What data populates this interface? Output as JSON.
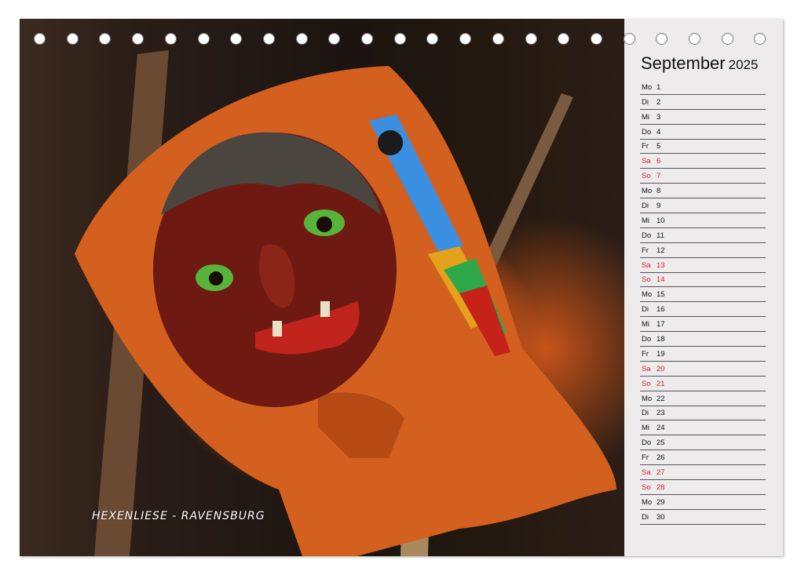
{
  "photo": {
    "caption": "HEXENLIESE - RAVENSBURG"
  },
  "calendar": {
    "month": "September",
    "year": "2025",
    "accent_weekend_color": "#d0202a",
    "days": [
      {
        "wd": "Mo",
        "d": "1",
        "weekend": false
      },
      {
        "wd": "Di",
        "d": "2",
        "weekend": false
      },
      {
        "wd": "Mi",
        "d": "3",
        "weekend": false
      },
      {
        "wd": "Do",
        "d": "4",
        "weekend": false
      },
      {
        "wd": "Fr",
        "d": "5",
        "weekend": false
      },
      {
        "wd": "Sa",
        "d": "6",
        "weekend": true
      },
      {
        "wd": "So",
        "d": "7",
        "weekend": true
      },
      {
        "wd": "Mo",
        "d": "8",
        "weekend": false
      },
      {
        "wd": "Di",
        "d": "9",
        "weekend": false
      },
      {
        "wd": "Mi",
        "d": "10",
        "weekend": false
      },
      {
        "wd": "Do",
        "d": "11",
        "weekend": false
      },
      {
        "wd": "Fr",
        "d": "12",
        "weekend": false
      },
      {
        "wd": "Sa",
        "d": "13",
        "weekend": true
      },
      {
        "wd": "So",
        "d": "14",
        "weekend": true
      },
      {
        "wd": "Mo",
        "d": "15",
        "weekend": false
      },
      {
        "wd": "Di",
        "d": "16",
        "weekend": false
      },
      {
        "wd": "Mi",
        "d": "17",
        "weekend": false
      },
      {
        "wd": "Do",
        "d": "18",
        "weekend": false
      },
      {
        "wd": "Fr",
        "d": "19",
        "weekend": false
      },
      {
        "wd": "Sa",
        "d": "20",
        "weekend": true
      },
      {
        "wd": "So",
        "d": "21",
        "weekend": true
      },
      {
        "wd": "Mo",
        "d": "22",
        "weekend": false
      },
      {
        "wd": "Di",
        "d": "23",
        "weekend": false
      },
      {
        "wd": "Mi",
        "d": "24",
        "weekend": false
      },
      {
        "wd": "Do",
        "d": "25",
        "weekend": false
      },
      {
        "wd": "Fr",
        "d": "26",
        "weekend": false
      },
      {
        "wd": "Sa",
        "d": "27",
        "weekend": true
      },
      {
        "wd": "So",
        "d": "28",
        "weekend": true
      },
      {
        "wd": "Mo",
        "d": "29",
        "weekend": false
      },
      {
        "wd": "Di",
        "d": "30",
        "weekend": false
      }
    ]
  }
}
